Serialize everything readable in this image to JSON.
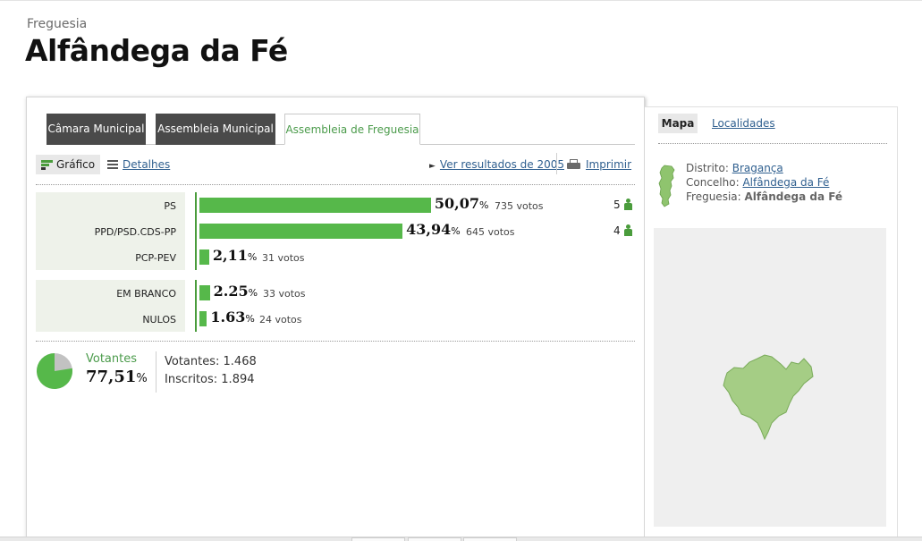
{
  "header": {
    "kicker": "Freguesia",
    "title": "Alfândega da Fé"
  },
  "tabs": [
    {
      "label": "Câmara Municipal",
      "active": false
    },
    {
      "label": "Assembleia Municipal",
      "active": false
    },
    {
      "label": "Assembleia de Freguesia",
      "active": true
    }
  ],
  "toolbar": {
    "grafico_label": "Gráfico",
    "detalhes_label": "Detalhes",
    "results_2005_label": "Ver resultados de 2005",
    "print_label": "Imprimir"
  },
  "colors": {
    "bar": "#56b84a",
    "accent": "#4b9b4b",
    "link": "#2f5f8f",
    "tab_dark": "#4a4a4a"
  },
  "chart_data": {
    "type": "bar",
    "parties": [
      {
        "name": "PS",
        "pct_text": "50,07",
        "pct": 50.07,
        "votes": "735 votos",
        "seats": "5"
      },
      {
        "name": "PPD/PSD.CDS-PP",
        "pct_text": "43,94",
        "pct": 43.94,
        "votes": "645 votos",
        "seats": "4"
      },
      {
        "name": "PCP-PEV",
        "pct_text": "2,11",
        "pct": 2.11,
        "votes": "31 votos",
        "seats": ""
      }
    ],
    "others": [
      {
        "name": "EM BRANCO",
        "pct_text": "2.25",
        "pct": 2.25,
        "votes": "33 votos"
      },
      {
        "name": "NULOS",
        "pct_text": "1.63",
        "pct": 1.63,
        "votes": "24 votos"
      }
    ],
    "percent_sign": "%"
  },
  "turnout": {
    "label": "Votantes",
    "pct_text": "77,51",
    "pct": 77.51,
    "percent_sign": "%",
    "votantes_line": "Votantes: 1.468",
    "inscritos_line": "Inscritos: 1.894",
    "color_voted": "#56b84a",
    "color_rest": "#c2c2c2"
  },
  "side": {
    "tab_mapa": "Mapa",
    "tab_localidades": "Localidades",
    "distrito_label": "Distrito:",
    "distrito_value": "Bragança",
    "concelho_label": "Concelho:",
    "concelho_value": "Alfândega da Fé",
    "freguesia_label": "Freguesia:",
    "freguesia_value": "Alfândega da Fé",
    "map_fill": "#a5cd85",
    "map_stroke": "#7aab5a"
  }
}
